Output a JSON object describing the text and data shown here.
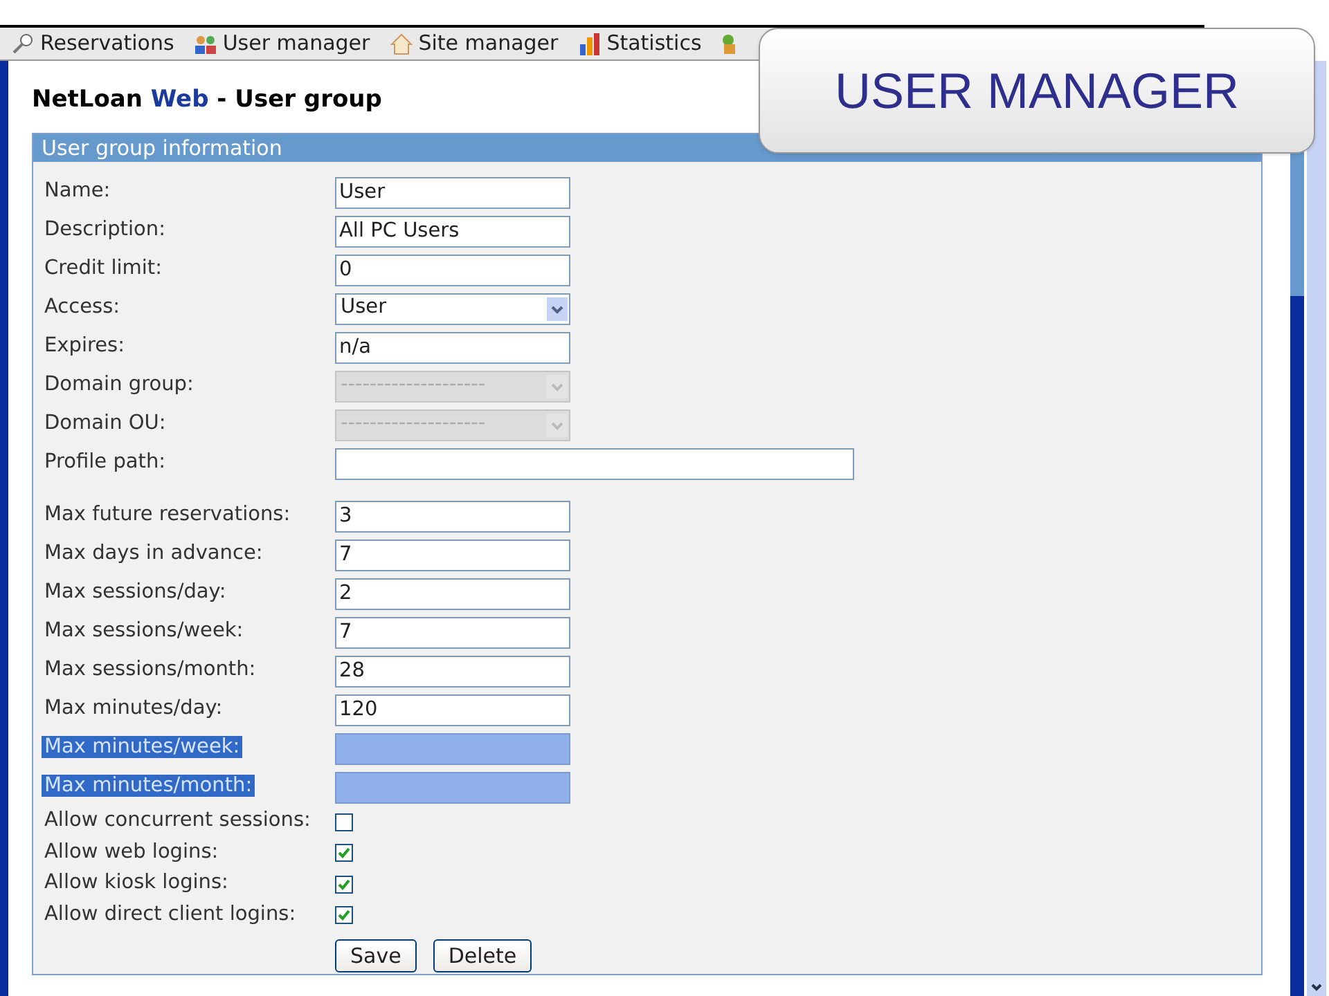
{
  "menu": [
    {
      "label": "Reservations"
    },
    {
      "label": "User manager"
    },
    {
      "label": "Site manager"
    },
    {
      "label": "Statistics"
    },
    {
      "kind": "icon_only"
    }
  ],
  "page_title": {
    "brand": "NetLoan",
    "brand_accent": "Web",
    "rest": "- User group"
  },
  "panel": {
    "title": "User group information",
    "fields": [
      {
        "kind": "text",
        "label": "Name:",
        "value": "User",
        "highlighted": false
      },
      {
        "kind": "text",
        "label": "Description:",
        "value": "All PC Users",
        "highlighted": false
      },
      {
        "kind": "text",
        "label": "Credit limit:",
        "value": "0",
        "highlighted": false
      },
      {
        "kind": "select",
        "label": "Access:",
        "value": "User",
        "disabled": false
      },
      {
        "kind": "text",
        "label": "Expires:",
        "value": "n/a",
        "highlighted": false
      },
      {
        "kind": "select",
        "label": "Domain group:",
        "value": "--------------------",
        "disabled": true
      },
      {
        "kind": "select",
        "label": "Domain OU:",
        "value": "--------------------",
        "disabled": true
      },
      {
        "kind": "wide",
        "label": "Profile path:",
        "highlighted": false
      },
      {
        "kind": "spacer"
      },
      {
        "kind": "text",
        "label": "Max future reservations:",
        "value": "3",
        "highlighted": false
      },
      {
        "kind": "text",
        "label": "Max days in advance:",
        "value": "7",
        "highlighted": false
      },
      {
        "kind": "text",
        "label": "Max sessions/day:",
        "value": "2",
        "highlighted": false
      },
      {
        "kind": "text",
        "label": "Max sessions/week:",
        "value": "7",
        "highlighted": false
      },
      {
        "kind": "text",
        "label": "Max sessions/month:",
        "value": "28",
        "highlighted": false
      },
      {
        "kind": "text",
        "label": "Max minutes/day:",
        "value": "120",
        "highlighted": false
      },
      {
        "kind": "text",
        "label": "Max minutes/week:",
        "highlighted": true
      },
      {
        "kind": "text",
        "label": "Max minutes/month:",
        "highlighted": true
      },
      {
        "kind": "checkbox",
        "label": "Allow concurrent sessions:",
        "checked": false
      },
      {
        "kind": "checkbox",
        "label": "Allow web logins:",
        "checked": true
      },
      {
        "kind": "checkbox",
        "label": "Allow kiosk logins:",
        "checked": true
      },
      {
        "kind": "checkbox",
        "label": "Allow direct client logins:",
        "checked": true
      }
    ],
    "buttons": [
      "Save",
      "Delete"
    ]
  },
  "callout": {
    "title": "USER MANAGER"
  }
}
